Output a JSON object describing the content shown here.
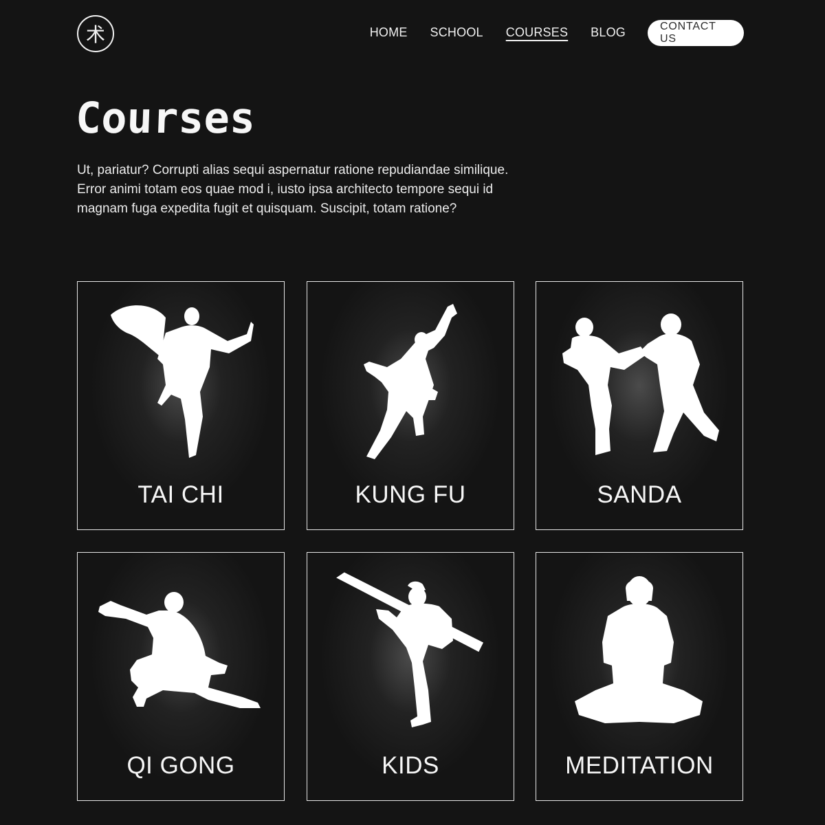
{
  "header": {
    "logo_glyph": "术",
    "nav": [
      {
        "label": "HOME",
        "active": false
      },
      {
        "label": "SCHOOL",
        "active": false
      },
      {
        "label": "COURSES",
        "active": true
      },
      {
        "label": "BLOG",
        "active": false
      }
    ],
    "contact_label": "CONTACT US"
  },
  "main": {
    "title": "Courses",
    "intro": "Ut, pariatur? Corrupti alias sequi aspernatur ratione repudiandae similique. Error animi totam eos quae mod i, iusto ipsa architecto tempore sequi id magnam fuga expedita fugit et quisquam. Suscipit, totam ratione?",
    "courses": [
      {
        "label": "TAI CHI",
        "icon": "tai-chi-silhouette-icon"
      },
      {
        "label": "KUNG FU",
        "icon": "kung-fu-silhouette-icon"
      },
      {
        "label": "SANDA",
        "icon": "sanda-silhouette-icon"
      },
      {
        "label": "QI GONG",
        "icon": "qi-gong-silhouette-icon"
      },
      {
        "label": "KIDS",
        "icon": "kids-silhouette-icon"
      },
      {
        "label": "MEDITATION",
        "icon": "meditation-silhouette-icon"
      }
    ]
  },
  "colors": {
    "background": "#141414",
    "text": "#f2f2f2",
    "button_bg": "#ffffff",
    "button_text": "#2a2a2a"
  }
}
